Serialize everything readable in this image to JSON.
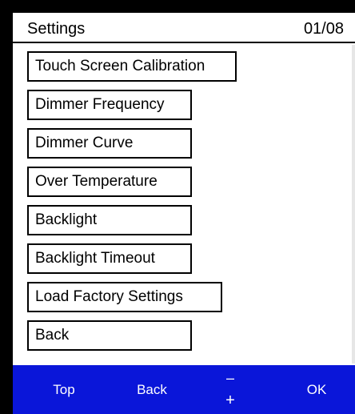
{
  "header": {
    "title": "Settings",
    "page_indicator": "01/08"
  },
  "menu": {
    "items": [
      {
        "label": "Touch Screen Calibration"
      },
      {
        "label": "Dimmer Frequency"
      },
      {
        "label": "Dimmer Curve"
      },
      {
        "label": "Over Temperature"
      },
      {
        "label": "Backlight"
      },
      {
        "label": "Backlight Timeout"
      },
      {
        "label": "Load Factory Settings"
      },
      {
        "label": "Back"
      }
    ]
  },
  "softkeys": {
    "top": "Top",
    "back": "Back",
    "minus": "–",
    "plus": "+",
    "ok": "OK"
  },
  "colors": {
    "accent": "#0a16d9",
    "background": "#ffffff",
    "text": "#000000"
  }
}
